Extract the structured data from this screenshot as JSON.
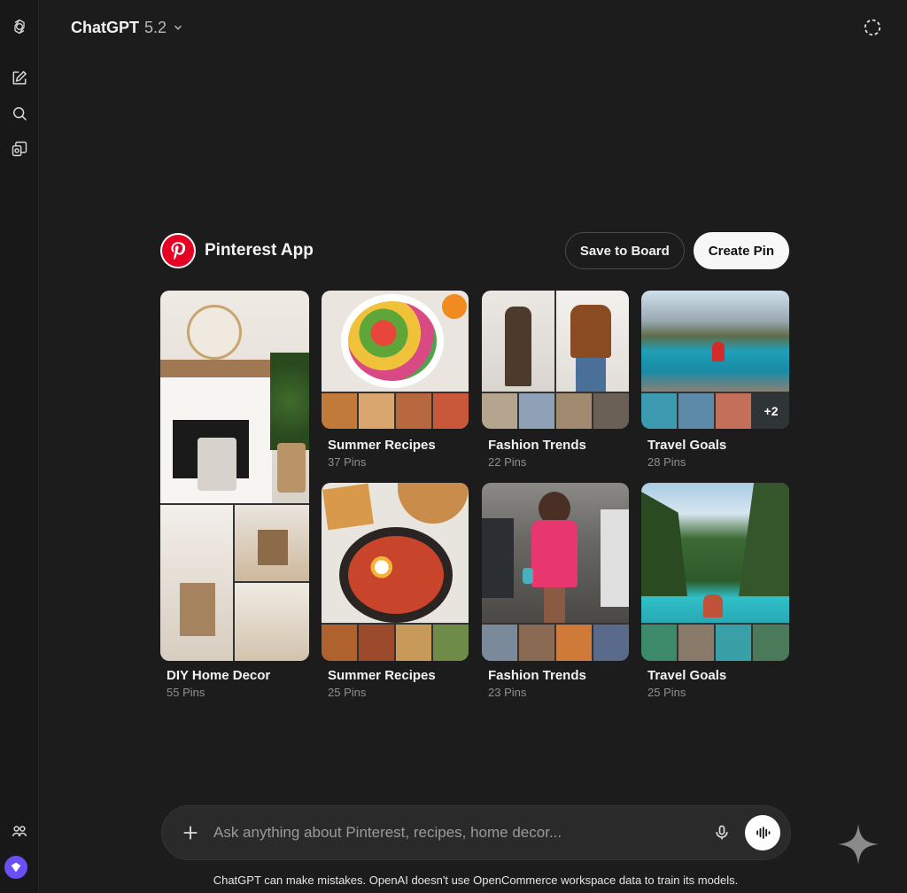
{
  "header": {
    "model_name": "ChatGPT",
    "model_version": "5.2"
  },
  "sidebar": {
    "items": [
      {
        "icon": "new-chat-icon"
      },
      {
        "icon": "search-icon"
      },
      {
        "icon": "library-icon"
      },
      {
        "icon": "group-icon"
      }
    ]
  },
  "app": {
    "title": "Pinterest App",
    "save_label": "Save to Board",
    "create_label": "Create Pin",
    "brand_color": "#e60023"
  },
  "boards": [
    {
      "name": "DIY Home Decor",
      "count": "55 Pins"
    },
    {
      "name": "Summer Recipes",
      "count": "37 Pins"
    },
    {
      "name": "Fashion Trends",
      "count": "22 Pins"
    },
    {
      "name": "Travel Goals",
      "count": "28 Pins",
      "extra": "+2"
    },
    {
      "name": "Summer Recipes",
      "count": "25 Pins"
    },
    {
      "name": "Fashion Trends",
      "count": "23 Pins"
    },
    {
      "name": "Travel Goals",
      "count": "25 Pins"
    }
  ],
  "composer": {
    "placeholder": "Ask anything about Pinterest, recipes, home decor..."
  },
  "footer": {
    "disclaimer": "ChatGPT can make mistakes. OpenAI doesn't use OpenCommerce workspace data to train its models."
  }
}
